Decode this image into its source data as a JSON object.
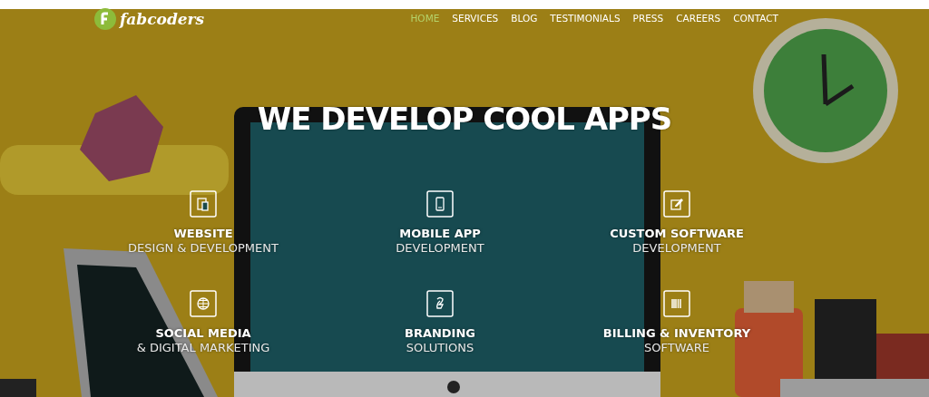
{
  "logo": {
    "text": "fabcoders"
  },
  "nav": [
    {
      "label": "HOME",
      "selected": true
    },
    {
      "label": "SERVICES",
      "selected": false
    },
    {
      "label": "BLOG",
      "selected": false
    },
    {
      "label": "TESTIMONIALS",
      "selected": false
    },
    {
      "label": "PRESS",
      "selected": false
    },
    {
      "label": "CAREERS",
      "selected": false
    },
    {
      "label": "CONTACT",
      "selected": false
    }
  ],
  "headline": "WE DEVELOP COOL APPS",
  "services": [
    {
      "kind": "devices",
      "title": "WEBSITE",
      "subtitle": "DESIGN & DEVELOPMENT"
    },
    {
      "kind": "phone",
      "title": "MOBILE APP",
      "subtitle": "DEVELOPMENT"
    },
    {
      "kind": "edit",
      "title": "CUSTOM SOFTWARE",
      "subtitle": "DEVELOPMENT"
    },
    {
      "kind": "globe",
      "title": "SOCIAL MEDIA",
      "subtitle": "& DIGITAL MARKETING"
    },
    {
      "kind": "brand",
      "title": "BRANDING",
      "subtitle": "SOLUTIONS"
    },
    {
      "kind": "barcode",
      "title": "BILLING & INVENTORY",
      "subtitle": "SOFTWARE"
    }
  ]
}
